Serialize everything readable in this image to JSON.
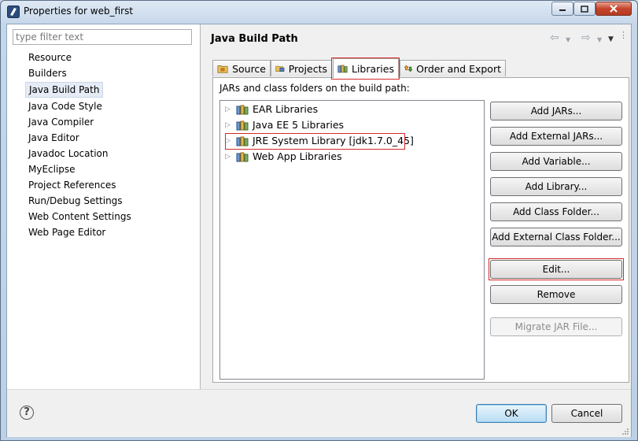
{
  "window": {
    "title": "Properties for web_first"
  },
  "sidebar": {
    "filter_placeholder": "type filter text",
    "items": [
      {
        "label": "Resource"
      },
      {
        "label": "Builders"
      },
      {
        "label": "Java Build Path",
        "selected": true
      },
      {
        "label": "Java Code Style"
      },
      {
        "label": "Java Compiler"
      },
      {
        "label": "Java Editor"
      },
      {
        "label": "Javadoc Location"
      },
      {
        "label": "MyEclipse"
      },
      {
        "label": "Project References"
      },
      {
        "label": "Run/Debug Settings"
      },
      {
        "label": "Web Content Settings"
      },
      {
        "label": "Web Page Editor"
      }
    ]
  },
  "main": {
    "title": "Java Build Path",
    "tabs": [
      {
        "label": "Source",
        "icon": "source-folder-icon"
      },
      {
        "label": "Projects",
        "icon": "projects-icon"
      },
      {
        "label": "Libraries",
        "icon": "libraries-icon",
        "active": true
      },
      {
        "label": "Order and Export",
        "icon": "order-export-icon"
      }
    ],
    "panel_label": "JARs and class folders on the build path:",
    "libraries": [
      {
        "label": "EAR Libraries"
      },
      {
        "label": "Java EE 5 Libraries"
      },
      {
        "label": "JRE System Library [jdk1.7.0_45]",
        "highlighted": true
      },
      {
        "label": "Web App Libraries"
      }
    ],
    "buttons": {
      "add_jars": "Add JARs...",
      "add_external_jars": "Add External JARs...",
      "add_variable": "Add Variable...",
      "add_library": "Add Library...",
      "add_class_folder": "Add Class Folder...",
      "add_external_class_folder": "Add External Class Folder...",
      "edit": "Edit...",
      "remove": "Remove",
      "migrate_jar": "Migrate JAR File..."
    }
  },
  "footer": {
    "ok": "OK",
    "cancel": "Cancel"
  },
  "colors": {
    "highlight": "#d42a2a",
    "accent": "#3c7fb1"
  }
}
